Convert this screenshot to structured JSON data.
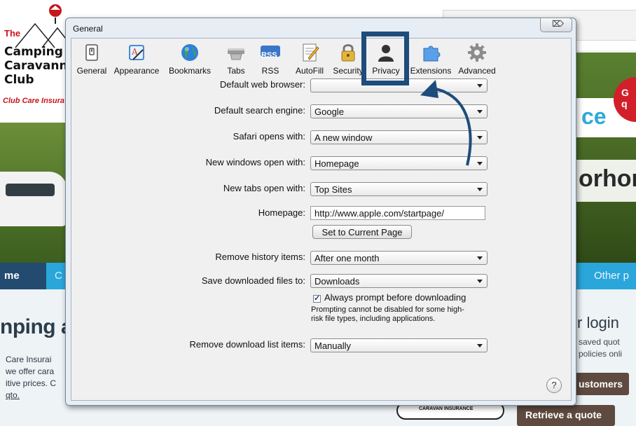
{
  "background_site": {
    "logo_the": "The",
    "logo_line1": "Camping",
    "logo_line2": "Caravanni",
    "logo_line3": "Club",
    "logo_insurance": "Club Care Insura",
    "cta_partial": "ce",
    "badge_partial": "G\nq",
    "banner_partial": "orhom",
    "nav_home": "me",
    "nav_c": "C",
    "nav_other": "Other p",
    "headline": "nping a",
    "para_line1": "Care Insurai",
    "para_line2": "we offer cara",
    "para_line3": "itive prices. C",
    "para_line4": "qto.",
    "login_title": "r login",
    "login_line1": "saved quot",
    "login_line2": "policies onli",
    "btn_customers": "ustomers",
    "btn_quote": "Retrieve a quote",
    "bottom_logo_text": "CARAVAN INSURANCE"
  },
  "dialog": {
    "title": "General",
    "close_symbol": "⌦",
    "toolbar": [
      {
        "label": "General",
        "icon": "general-switch-icon"
      },
      {
        "label": "Appearance",
        "icon": "appearance-icon"
      },
      {
        "label": "Bookmarks",
        "icon": "globe-icon"
      },
      {
        "label": "Tabs",
        "icon": "tabs-icon"
      },
      {
        "label": "RSS",
        "icon": "rss-icon"
      },
      {
        "label": "AutoFill",
        "icon": "autofill-icon"
      },
      {
        "label": "Security",
        "icon": "lock-icon"
      },
      {
        "label": "Privacy",
        "icon": "privacy-person-icon"
      },
      {
        "label": "Extensions",
        "icon": "puzzle-icon"
      },
      {
        "label": "Advanced",
        "icon": "gear-icon"
      }
    ],
    "rss_badge": "RSS",
    "highlight_color": "#1e4c7b",
    "form": {
      "default_browser_label": "Default web browser:",
      "default_browser_value": "",
      "search_engine_label": "Default search engine:",
      "search_engine_value": "Google",
      "safari_opens_label": "Safari opens with:",
      "safari_opens_value": "A new window",
      "new_windows_label": "New windows open with:",
      "new_windows_value": "Homepage",
      "new_tabs_label": "New tabs open with:",
      "new_tabs_value": "Top Sites",
      "homepage_label": "Homepage:",
      "homepage_value": "http://www.apple.com/startpage/",
      "set_current_label": "Set to Current Page",
      "remove_history_label": "Remove history items:",
      "remove_history_value": "After one month",
      "save_downloads_label": "Save downloaded files to:",
      "save_downloads_value": "Downloads",
      "always_prompt_label": "Always prompt before downloading",
      "always_prompt_checked": true,
      "prompt_note_line1": "Prompting cannot be disabled for some high-",
      "prompt_note_line2": "risk file types, including applications.",
      "remove_download_label": "Remove download list items:",
      "remove_download_value": "Manually",
      "help_label": "?"
    }
  }
}
